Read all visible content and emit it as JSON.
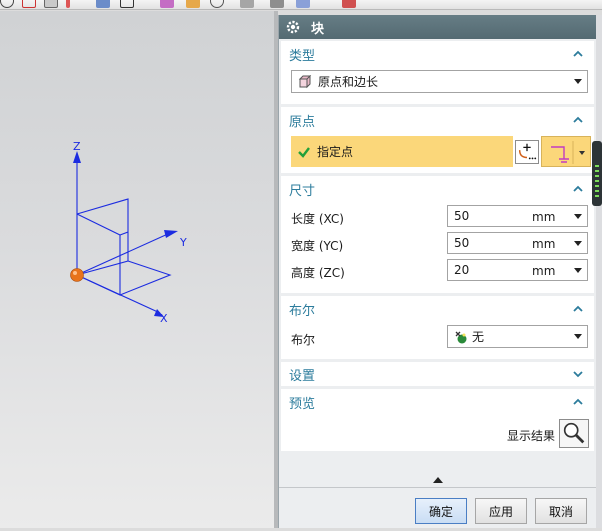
{
  "dialog": {
    "title": "块"
  },
  "sections": {
    "type": {
      "header": "类型",
      "selected": "原点和边长"
    },
    "origin": {
      "header": "原点",
      "specify_point": "指定点"
    },
    "dimensions": {
      "header": "尺寸",
      "rows": [
        {
          "label": "长度 (XC)",
          "value": "50",
          "unit": "mm"
        },
        {
          "label": "宽度 (YC)",
          "value": "50",
          "unit": "mm"
        },
        {
          "label": "高度 (ZC)",
          "value": "20",
          "unit": "mm"
        }
      ]
    },
    "boolean": {
      "header": "布尔",
      "label": "布尔",
      "selected": "无"
    },
    "settings": {
      "header": "设置"
    },
    "preview": {
      "header": "预览",
      "show_result": "显示结果"
    }
  },
  "buttons": {
    "ok": "确定",
    "apply": "应用",
    "cancel": "取消"
  },
  "axes": {
    "x": "X",
    "y": "Y",
    "z": "Z"
  },
  "colors": {
    "section_header": "#2c7c9c",
    "title_bar": "#5b727a",
    "specify_highlight": "#fbd77a",
    "axis_blue": "#1c2ce0",
    "origin_orange": "#e8731b"
  }
}
